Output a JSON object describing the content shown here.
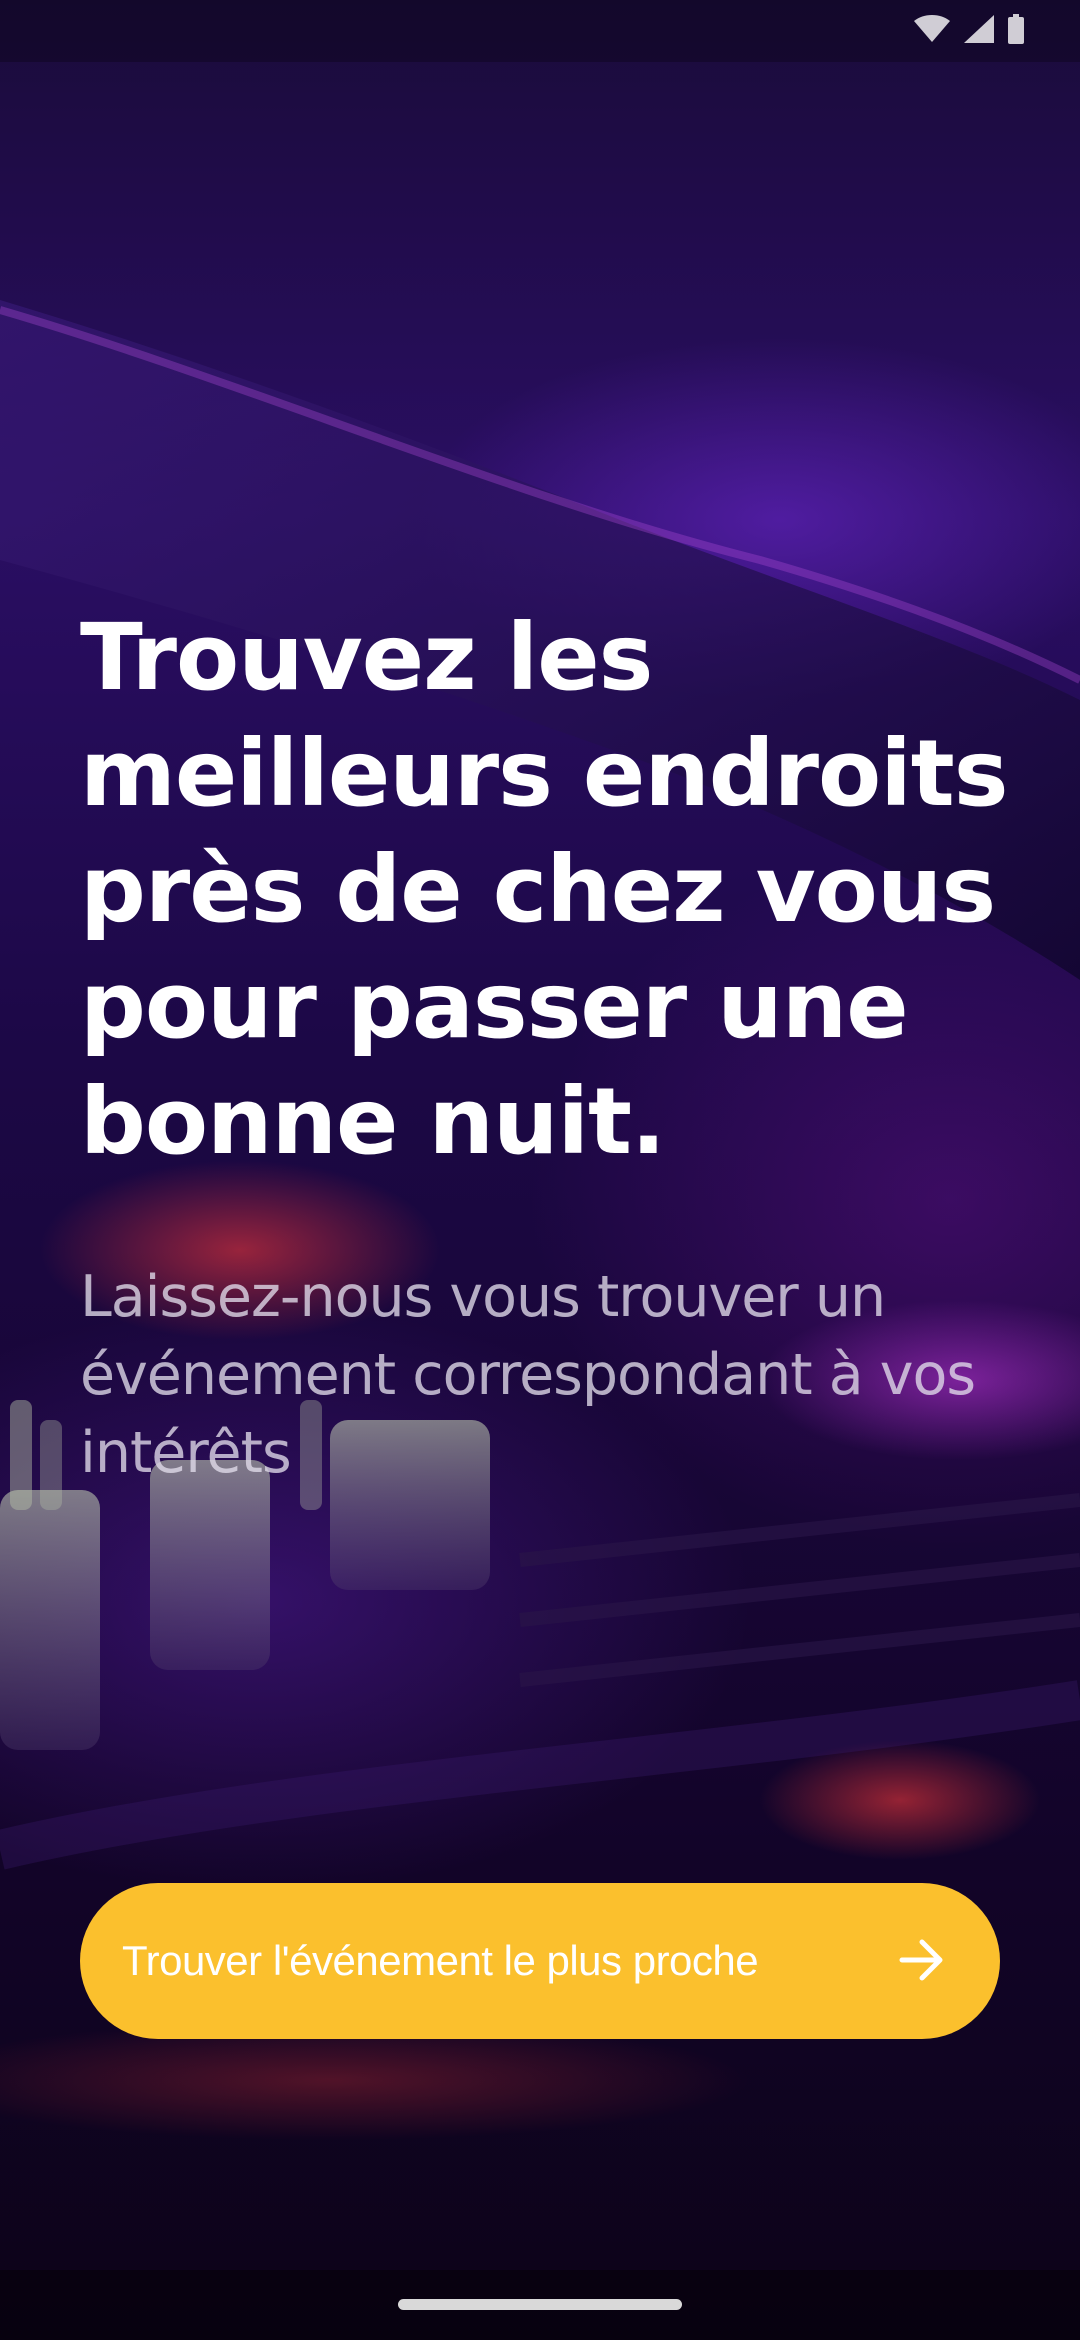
{
  "status_bar": {
    "icons": [
      "wifi-icon",
      "signal-icon",
      "battery-icon"
    ]
  },
  "onboarding": {
    "headline": "Trouvez les meilleurs endroits près de chez vous pour passer une bonne nuit.",
    "subtitle": "Laissez-nous vous trouver un événement correspondant à vos intérêts",
    "cta_label": "Trouver l'événement le plus proche",
    "cta_icon": "arrow-right-icon"
  },
  "colors": {
    "accent": "#fbc02d",
    "background_purple": "#2a0e63",
    "text_primary": "#ffffff"
  }
}
